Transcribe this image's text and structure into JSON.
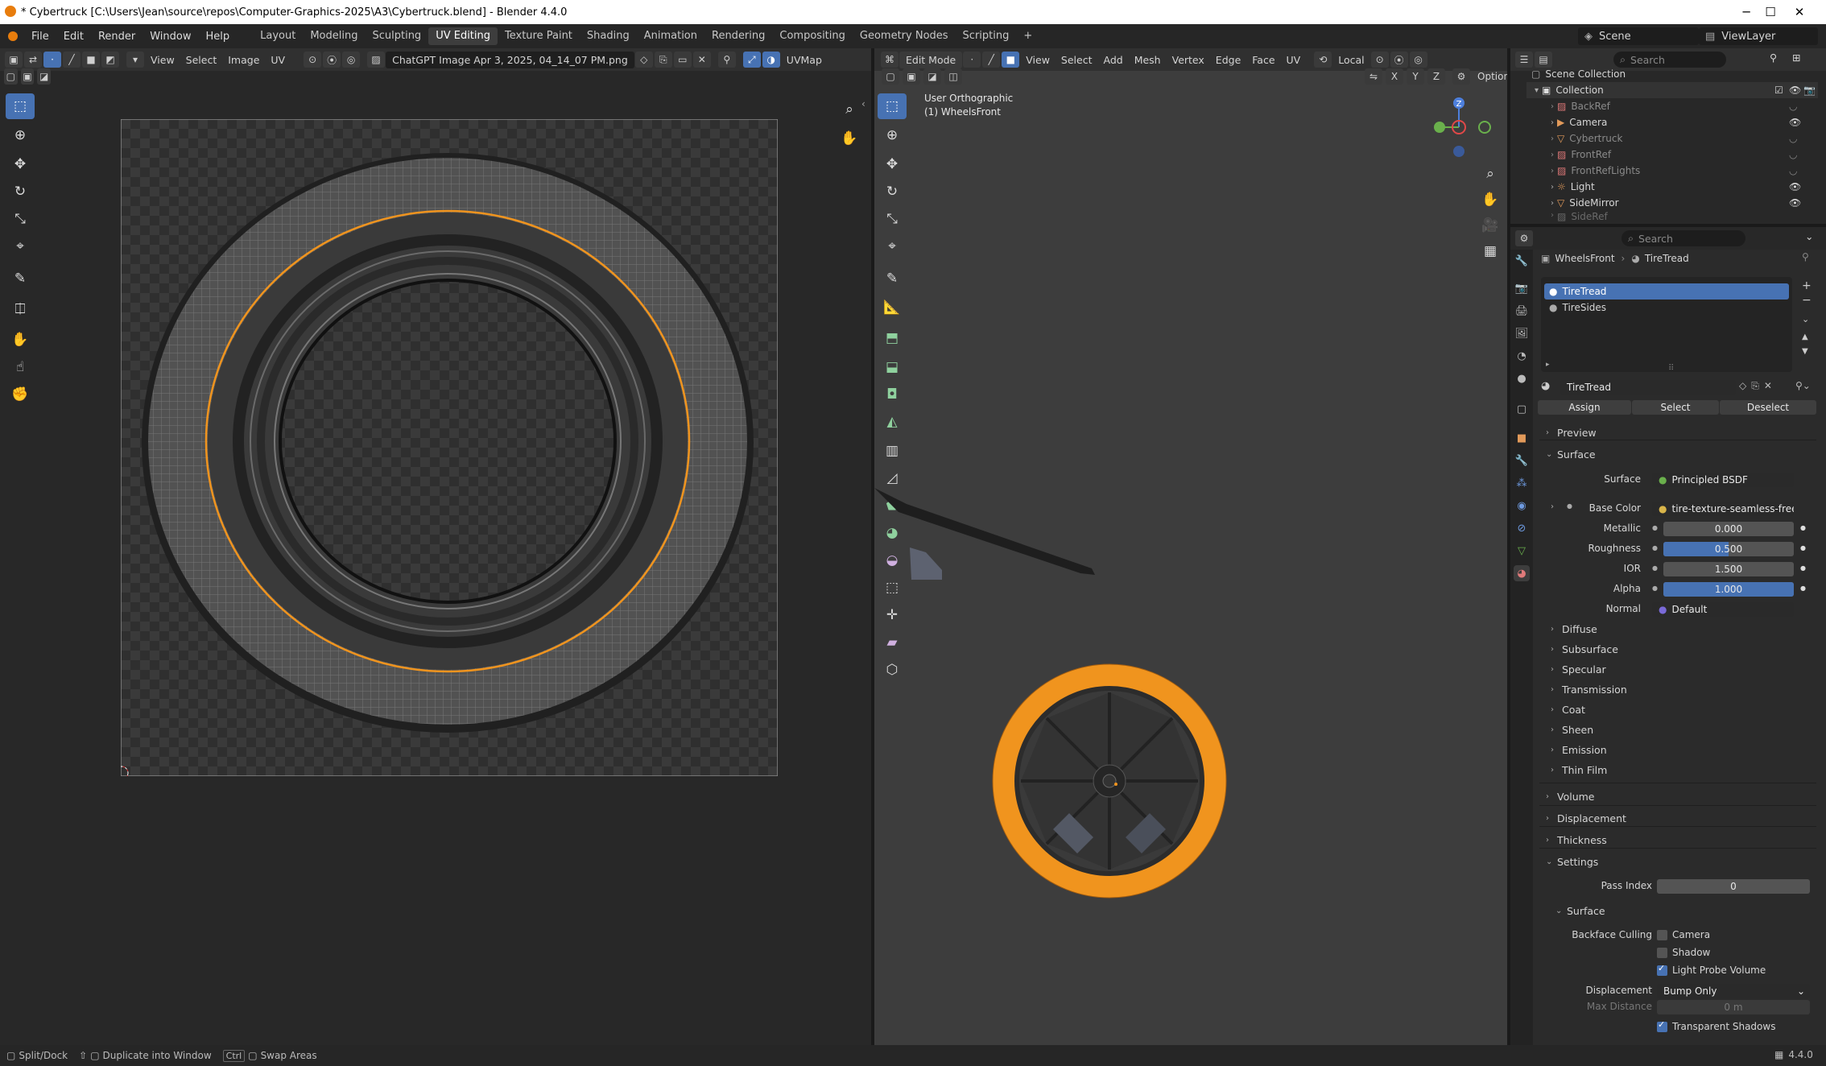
{
  "window": {
    "title": "* Cybertruck [C:\\Users\\Jean\\source\\repos\\Computer-Graphics-2025\\A3\\Cybertruck.blend] - Blender 4.4.0"
  },
  "menu": [
    "File",
    "Edit",
    "Render",
    "Window",
    "Help"
  ],
  "workspaces": [
    "Layout",
    "Modeling",
    "Sculpting",
    "UV Editing",
    "Texture Paint",
    "Shading",
    "Animation",
    "Rendering",
    "Compositing",
    "Geometry Nodes",
    "Scripting"
  ],
  "active_workspace": "UV Editing",
  "scene": {
    "label": "Scene",
    "viewlayer": "ViewLayer"
  },
  "uv_editor": {
    "menus": [
      "View",
      "Select",
      "Image",
      "UV"
    ],
    "image_name": "ChatGPT Image Apr 3, 2025, 04_14_07 PM.png",
    "uvmap": "UVMap"
  },
  "viewport": {
    "mode": "Edit Mode",
    "menus": [
      "View",
      "Select",
      "Add",
      "Mesh",
      "Vertex",
      "Edge",
      "Face",
      "UV"
    ],
    "transform": "Local",
    "options": "Options",
    "axes": [
      "X",
      "Y",
      "Z"
    ],
    "overlay_title": "User Orthographic",
    "overlay_object": "(1) WheelsFront",
    "gizmo": {
      "z": "Z"
    }
  },
  "outliner": {
    "search_placeholder": "Search",
    "root": "Scene Collection",
    "collection": "Collection",
    "items": [
      "BackRef",
      "Camera",
      "Cybertruck",
      "FrontRef",
      "FrontRefLights",
      "Light",
      "SideMirror",
      "SideRef"
    ]
  },
  "properties": {
    "search_placeholder": "Search",
    "breadcrumb": {
      "object": "WheelsFront",
      "material": "TireTread"
    },
    "slots": [
      "TireTread",
      "TireSides"
    ],
    "material_name": "TireTread",
    "assign": "Assign",
    "select": "Select",
    "deselect": "Deselect",
    "preview": "Preview",
    "surface_header": "Surface",
    "fields": {
      "surface_label": "Surface",
      "surface_value": "Principled BSDF",
      "base_color_label": "Base Color",
      "base_color_value": "tire-texture-seamless-free....",
      "metallic_label": "Metallic",
      "metallic_value": "0.000",
      "roughness_label": "Roughness",
      "roughness_value": "0.500",
      "ior_label": "IOR",
      "ior_value": "1.500",
      "alpha_label": "Alpha",
      "alpha_value": "1.000",
      "normal_label": "Normal",
      "normal_value": "Default"
    },
    "fill": {
      "metallic": 0.0,
      "roughness": 0.5,
      "ior": 0.0,
      "alpha": 1.0
    },
    "subpanels": [
      "Diffuse",
      "Subsurface",
      "Specular",
      "Transmission",
      "Coat",
      "Sheen",
      "Emission",
      "Thin Film"
    ],
    "panels": [
      "Volume",
      "Displacement",
      "Thickness",
      "Settings"
    ],
    "settings": {
      "pass_index_label": "Pass Index",
      "pass_index_value": "0",
      "surface": "Surface",
      "backface_culling": "Backface Culling",
      "camera": "Camera",
      "shadow": "Shadow",
      "light_probe_volume": "Light Probe Volume",
      "displacement_label": "Displacement",
      "displacement_value": "Bump Only",
      "max_distance_label": "Max Distance",
      "max_distance_value": "0 m",
      "transparent_shadows": "Transparent Shadows"
    }
  },
  "statusbar": {
    "split": "Split/Dock",
    "duplicate": "Duplicate into Window",
    "ctrl": "Ctrl",
    "swap": "Swap Areas",
    "version": "4.4.0"
  },
  "colors": {
    "accent": "#4772b3",
    "selection": "#f0941e",
    "bg": "#1d1d1d",
    "panel": "#303030"
  }
}
